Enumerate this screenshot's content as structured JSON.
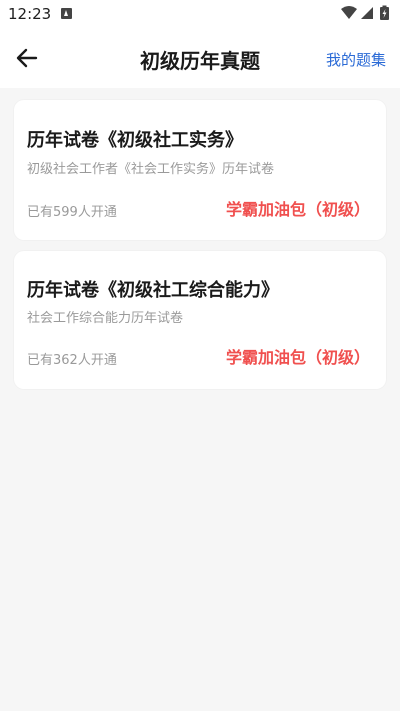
{
  "status_bar": {
    "time": "12:23",
    "icons": [
      "notification-a-icon",
      "wifi-icon",
      "signal-icon",
      "battery-charging-icon"
    ]
  },
  "header": {
    "title": "初级历年真题",
    "right_action": "我的题集"
  },
  "cards": [
    {
      "title": "历年试卷《初级社工实务》",
      "subtitle": "初级社会工作者《社会工作实务》历年试卷",
      "count_text": "已有599人开通",
      "tag": "学霸加油包（初级）"
    },
    {
      "title": "历年试卷《初级社工综合能力》",
      "subtitle": "社会工作综合能力历年试卷",
      "count_text": "已有362人开通",
      "tag": "学霸加油包（初级）"
    }
  ],
  "colors": {
    "accent_blue": "#2a6ad6",
    "tag_red": "#f0504f",
    "background": "#f6f6f6"
  }
}
